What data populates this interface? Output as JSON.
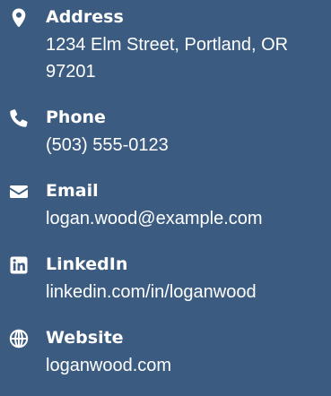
{
  "contact": {
    "address": {
      "icon": "map-marker-icon",
      "label": "Address",
      "value": "1234 Elm Street, Portland, OR 97201"
    },
    "phone": {
      "icon": "phone-icon",
      "label": "Phone",
      "value": "(503) 555-0123"
    },
    "email": {
      "icon": "envelope-icon",
      "label": "Email",
      "value": "logan.wood@example.com"
    },
    "linkedin": {
      "icon": "linkedin-icon",
      "label": "LinkedIn",
      "value": "linkedin.com/in/loganwood"
    },
    "website": {
      "icon": "globe-icon",
      "label": "Website",
      "value": "loganwood.com"
    }
  },
  "colors": {
    "background": "#3b5c80",
    "text": "#ffffff"
  }
}
